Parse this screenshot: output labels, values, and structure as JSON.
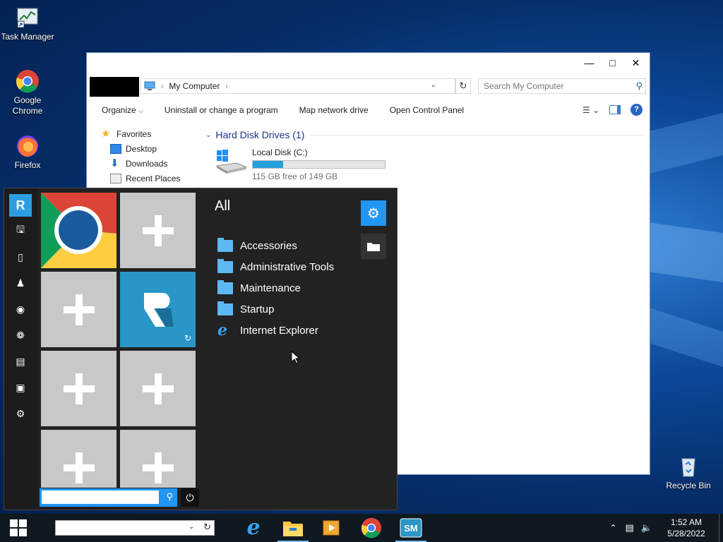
{
  "desktop": {
    "icons": [
      {
        "label": "Task Manager",
        "icon": "task-manager-icon"
      },
      {
        "label": "Google Chrome",
        "icon": "chrome-icon"
      },
      {
        "label": "Firefox",
        "icon": "firefox-icon"
      },
      {
        "label": "Recycle Bin",
        "icon": "recycle-bin-icon"
      }
    ]
  },
  "explorer": {
    "address": {
      "location": "My Computer"
    },
    "search": {
      "placeholder": "Search My Computer"
    },
    "commands": [
      "Organize",
      "Uninstall or change a program",
      "Map network drive",
      "Open Control Panel"
    ],
    "nav": [
      {
        "label": "Favorites",
        "icon": "star-icon"
      },
      {
        "label": "Desktop",
        "icon": "desktop-folder-icon"
      },
      {
        "label": "Downloads",
        "icon": "download-arrow-icon"
      },
      {
        "label": "Recent Places",
        "icon": "recent-places-icon"
      }
    ],
    "group": {
      "label": "Hard Disk Drives (1)"
    },
    "drive": {
      "name": "Local Disk (C:)",
      "free_text": "115 GB free of 149 GB",
      "used_fraction": 0.23
    }
  },
  "start_menu": {
    "panel_title": "All",
    "programs": [
      {
        "label": "Accessories",
        "icon": "folder-icon"
      },
      {
        "label": "Administrative Tools",
        "icon": "folder-icon"
      },
      {
        "label": "Maintenance",
        "icon": "folder-icon"
      },
      {
        "label": "Startup",
        "icon": "folder-icon"
      },
      {
        "label": "Internet Explorer",
        "icon": "internet-explorer-icon"
      }
    ],
    "search_value": ""
  },
  "taskbar": {
    "address_value": "",
    "pinned": [
      "internet-explorer-icon",
      "file-explorer-icon",
      "media-player-icon",
      "chrome-icon",
      "start-menu-app-icon"
    ],
    "clock": {
      "time": "1:52 AM",
      "date": "5/28/2022"
    }
  },
  "colors": {
    "accent": "#2196f3",
    "drive_fill": "#26a0da",
    "tile_empty": "#c8c8c8"
  }
}
